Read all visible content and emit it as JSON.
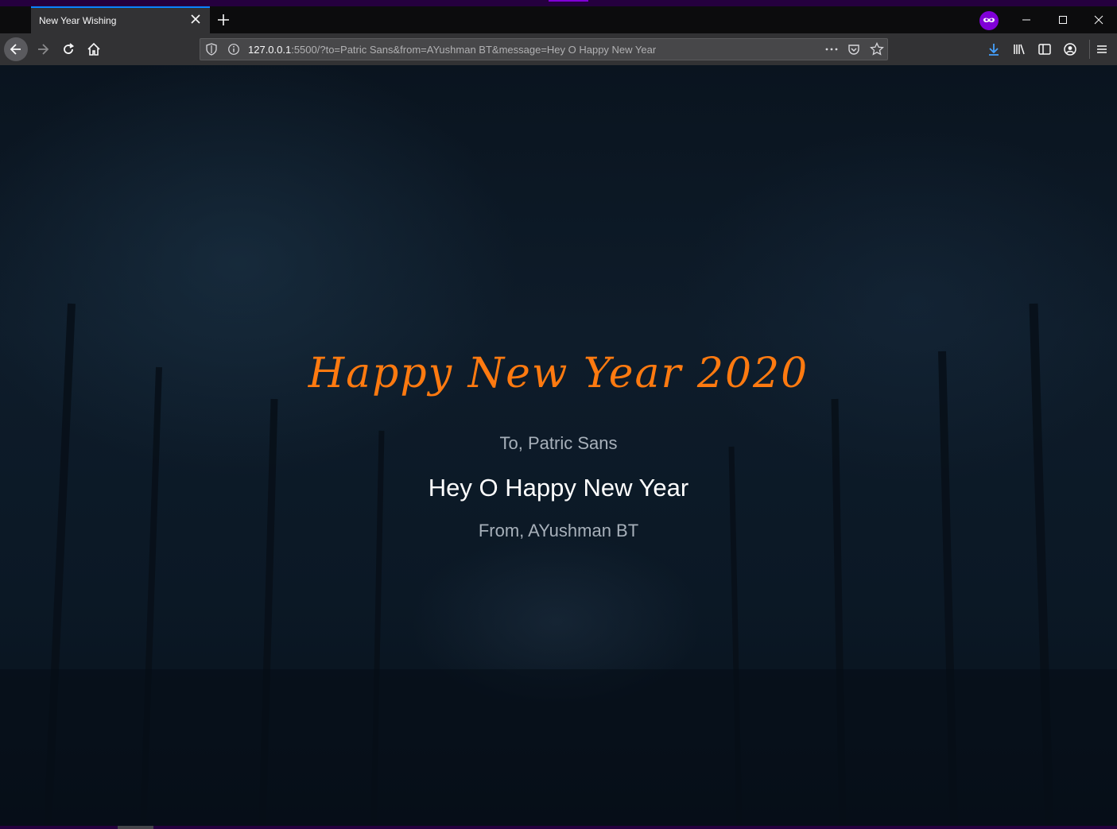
{
  "browser": {
    "tab_title": "New Year Wishing",
    "url_host": "127.0.0.1",
    "url_rest": ":5500/?to=Patric Sans&from=AYushman BT&message=Hey O Happy New Year",
    "accent_color": "#0a84ff",
    "private_color": "#8000d7"
  },
  "page": {
    "headline": "Happy New Year 2020",
    "to_line": "To, Patric Sans",
    "message": "Hey O Happy New Year",
    "from_line": "From, AYushman BT",
    "headline_color": "#ff7a10"
  }
}
